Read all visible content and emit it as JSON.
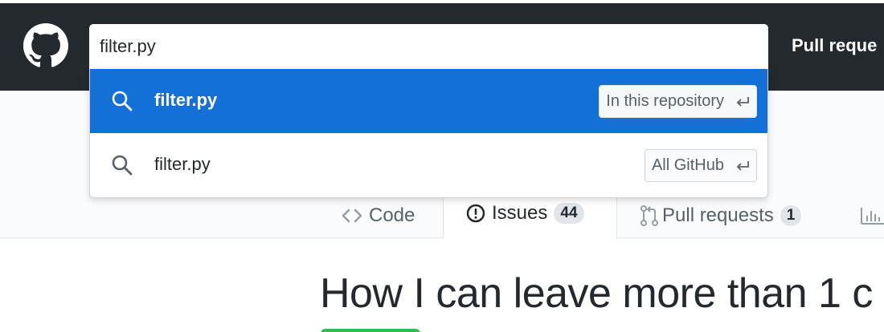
{
  "header": {
    "nav_pull_requests": "Pull reque"
  },
  "search": {
    "query": "filter.py",
    "suggestions": [
      {
        "text": "filter.py",
        "scope": "In this repository",
        "highlighted": true
      },
      {
        "text": "filter.py",
        "scope": "All GitHub",
        "highlighted": false
      }
    ]
  },
  "tabs": {
    "code": {
      "label": "Code",
      "icon": "code-icon"
    },
    "issues": {
      "label": "Issues",
      "count": "44",
      "icon": "issue-icon"
    },
    "pulls": {
      "label": "Pull requests",
      "count": "1",
      "icon": "git-pull-request-icon"
    },
    "insights": {
      "icon": "graph-icon"
    }
  },
  "issue": {
    "title": "How I can leave more than 1 c"
  },
  "colors": {
    "header_bg": "#24292e",
    "highlight": "#1370d6",
    "open_badge": "#2cbe4e"
  }
}
